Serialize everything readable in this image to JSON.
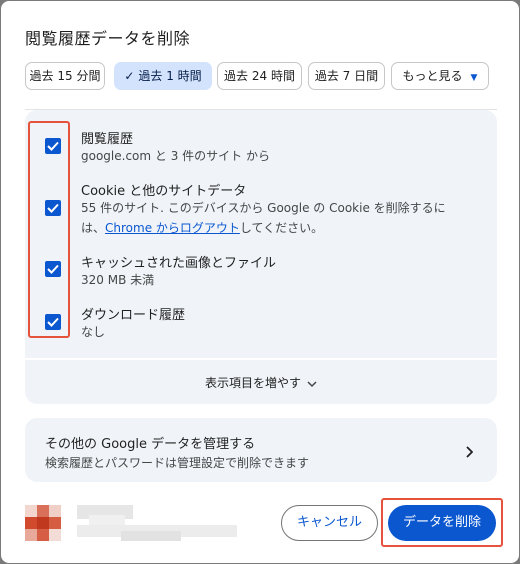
{
  "dialog": {
    "title": "閲覧履歴データを削除"
  },
  "time_range": {
    "options": [
      {
        "label": "過去 15 分間",
        "selected": false
      },
      {
        "label": "過去 1 時間",
        "selected": true
      },
      {
        "label": "過去 24 時間",
        "selected": false
      },
      {
        "label": "過去 7 日間",
        "selected": false
      }
    ],
    "more_label": "もっと見る"
  },
  "data_types": [
    {
      "title": "閲覧履歴",
      "desc": "google.com と 3 件のサイト から",
      "checked": true
    },
    {
      "title": "Cookie と他のサイトデータ",
      "desc_line1": "55 件のサイト. このデバイスから Google の Cookie を削除するに",
      "desc_line2_pre": "は、",
      "desc_link": "Chrome からログアウト",
      "desc_line2_post": "してください。",
      "checked": true
    },
    {
      "title": "キャッシュされた画像とファイル",
      "desc": "320 MB 未満",
      "checked": true
    },
    {
      "title": "ダウンロード履歴",
      "desc": "なし",
      "checked": true
    }
  ],
  "show_more": "表示項目を増やす",
  "manage": {
    "title": "その他の Google データを管理する",
    "desc": "検索履歴とパスワードは管理設定で削除できます"
  },
  "buttons": {
    "cancel": "キャンセル",
    "delete": "データを削除"
  },
  "colors": {
    "accent": "#0b57d0",
    "highlight": "#e5533c",
    "panel": "#f0f4f9"
  }
}
